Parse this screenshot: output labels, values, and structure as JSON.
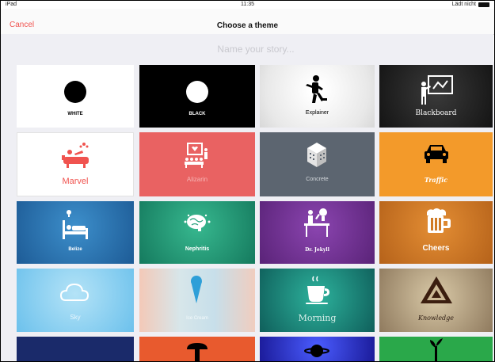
{
  "status_bar": {
    "device": "iPad",
    "time": "11:35",
    "battery_text": "Lädt nicht"
  },
  "nav": {
    "cancel_label": "Cancel",
    "title": "Choose a theme"
  },
  "story_name": {
    "value": "",
    "placeholder": "Name your story..."
  },
  "themes": [
    {
      "label": "WHITE",
      "icon": "circle-icon"
    },
    {
      "label": "BLACK",
      "icon": "circle-icon"
    },
    {
      "label": "Explainer",
      "icon": "explainer-figure-icon"
    },
    {
      "label": "Blackboard",
      "icon": "teacher-board-icon"
    },
    {
      "label": "Marvel",
      "icon": "bathtub-icon"
    },
    {
      "label": "Alizarin",
      "icon": "presentation-icon"
    },
    {
      "label": "Concrete",
      "icon": "building-icon"
    },
    {
      "label": "Traffic",
      "icon": "car-icon"
    },
    {
      "label": "Belize",
      "icon": "bed-idea-icon"
    },
    {
      "label": "Nephritis",
      "icon": "brain-icon"
    },
    {
      "label": "Dr. Jekyll",
      "icon": "lab-desk-icon"
    },
    {
      "label": "Cheers",
      "icon": "beer-mug-icon"
    },
    {
      "label": "Sky",
      "icon": "cloud-icon"
    },
    {
      "label": "Ice Cream",
      "icon": "ice-cream-icon"
    },
    {
      "label": "Morning",
      "icon": "coffee-cup-icon"
    },
    {
      "label": "Knowledge",
      "icon": "triangle-icon"
    },
    {
      "label": "",
      "icon": ""
    },
    {
      "label": "",
      "icon": "cup-icon"
    },
    {
      "label": "",
      "icon": "planet-icon"
    },
    {
      "label": "",
      "icon": "plant-icon"
    }
  ],
  "colors": {
    "accent": "#f0534f",
    "white_tile": "#ffffff",
    "black_tile": "#000000",
    "explainer_tile": "#eeeeee",
    "blackboard_tile": "#2a2a2a",
    "marvel_tile": "#ffffff",
    "alizarin_tile": "#e96262",
    "concrete_tile": "#5c6570",
    "traffic_tile": "#f39a2a",
    "belize_tile": "#2a78b5",
    "nephritis_tile": "#26a07c",
    "jekyll_tile": "#6b2f8e",
    "cheers_tile": "#d07a25",
    "sky_tile": "#8ed2f2",
    "icecream_tile": "#cde0e8",
    "morning_tile": "#1c8a7c",
    "knowledge_tile": "#b6a283"
  }
}
